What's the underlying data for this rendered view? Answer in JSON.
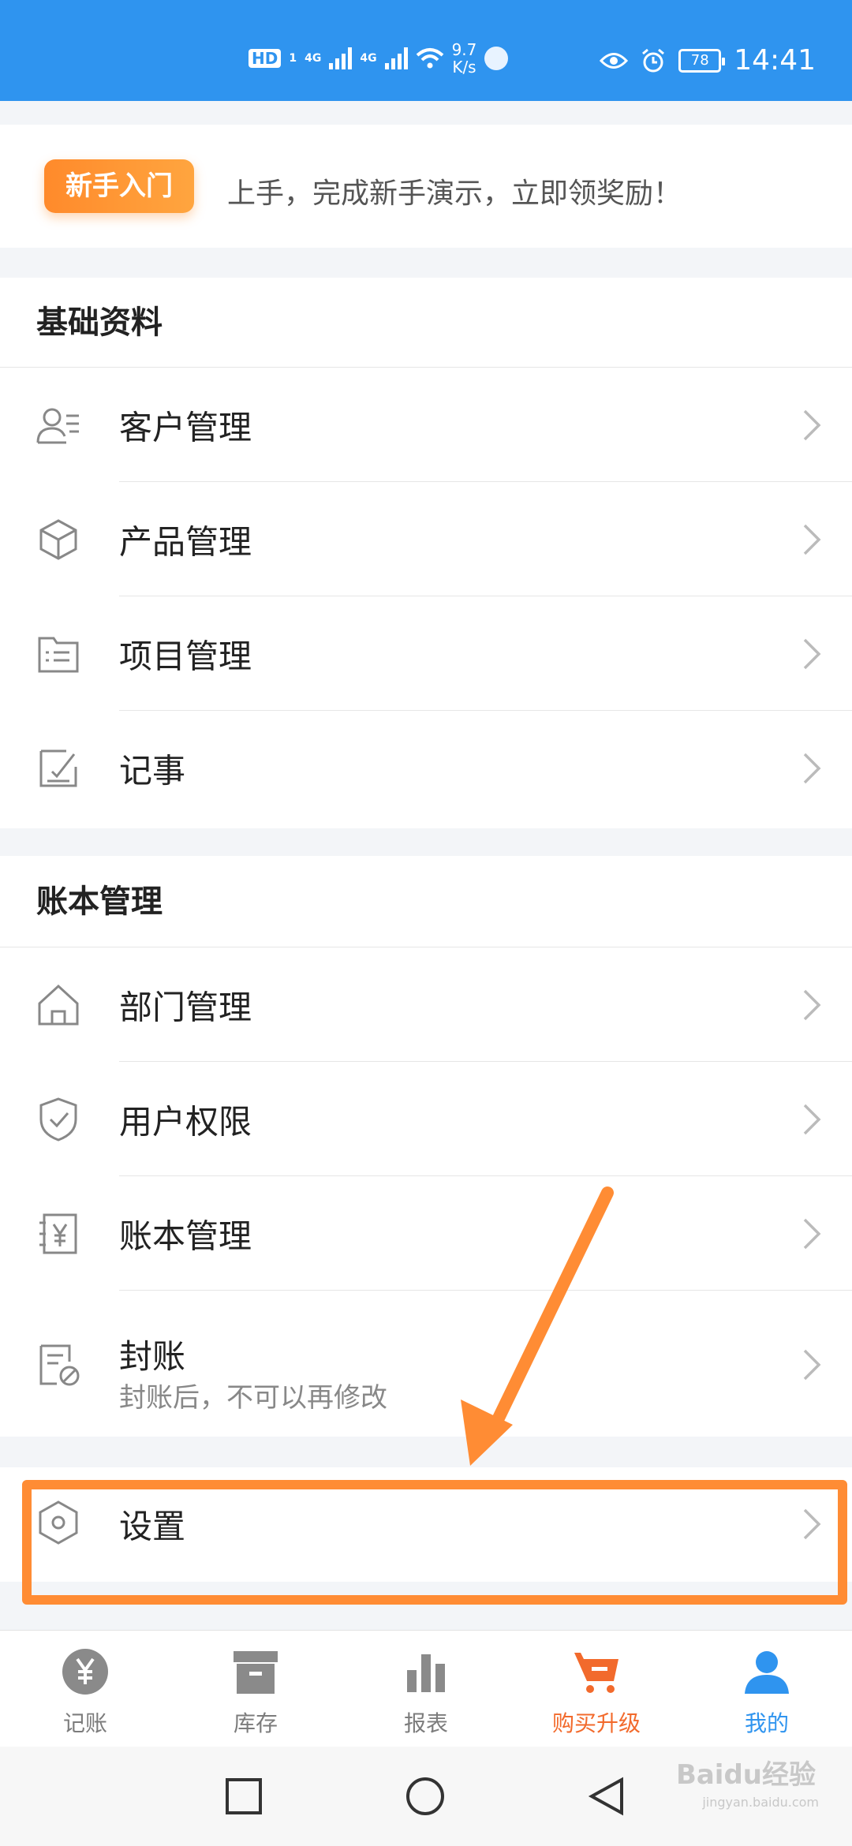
{
  "status_bar": {
    "hd_label": "HD",
    "hd_sub": "1",
    "sig1_label": "4G",
    "sig2_label": "4G",
    "net_speed_value": "9.7",
    "net_speed_unit": "K/s",
    "battery": "78",
    "time": "14:41"
  },
  "banner": {
    "badge": "新手入门",
    "text": "上手，完成新手演示，立即领奖励！"
  },
  "sections": {
    "basic": {
      "title": "基础资料",
      "items": [
        {
          "label": "客户管理",
          "icon": "customer-icon"
        },
        {
          "label": "产品管理",
          "icon": "product-box-icon"
        },
        {
          "label": "项目管理",
          "icon": "project-folder-icon"
        },
        {
          "label": "记事",
          "icon": "note-edit-icon"
        }
      ]
    },
    "ledger": {
      "title": "账本管理",
      "items": [
        {
          "label": "部门管理",
          "icon": "home-icon"
        },
        {
          "label": "用户权限",
          "icon": "shield-check-icon"
        },
        {
          "label": "账本管理",
          "icon": "ledger-yen-icon"
        },
        {
          "label": "封账",
          "sub": "封账后，不可以再修改",
          "icon": "closed-ledger-icon"
        }
      ]
    },
    "settings": {
      "label": "设置",
      "icon": "settings-hexagon-icon"
    }
  },
  "tabbar": {
    "tabs": [
      {
        "label": "记账",
        "icon": "yen-circle-icon"
      },
      {
        "label": "库存",
        "icon": "inventory-box-icon"
      },
      {
        "label": "报表",
        "icon": "bar-chart-icon"
      },
      {
        "label": "购买升级",
        "icon": "cart-icon"
      },
      {
        "label": "我的",
        "icon": "user-icon"
      }
    ]
  },
  "watermark": {
    "text": "Baidu经验",
    "sub": "jingyan.baidu.com"
  },
  "colors": {
    "primary": "#2f94ef",
    "accent": "#ff8c34",
    "inactive": "#7c7c7c"
  }
}
